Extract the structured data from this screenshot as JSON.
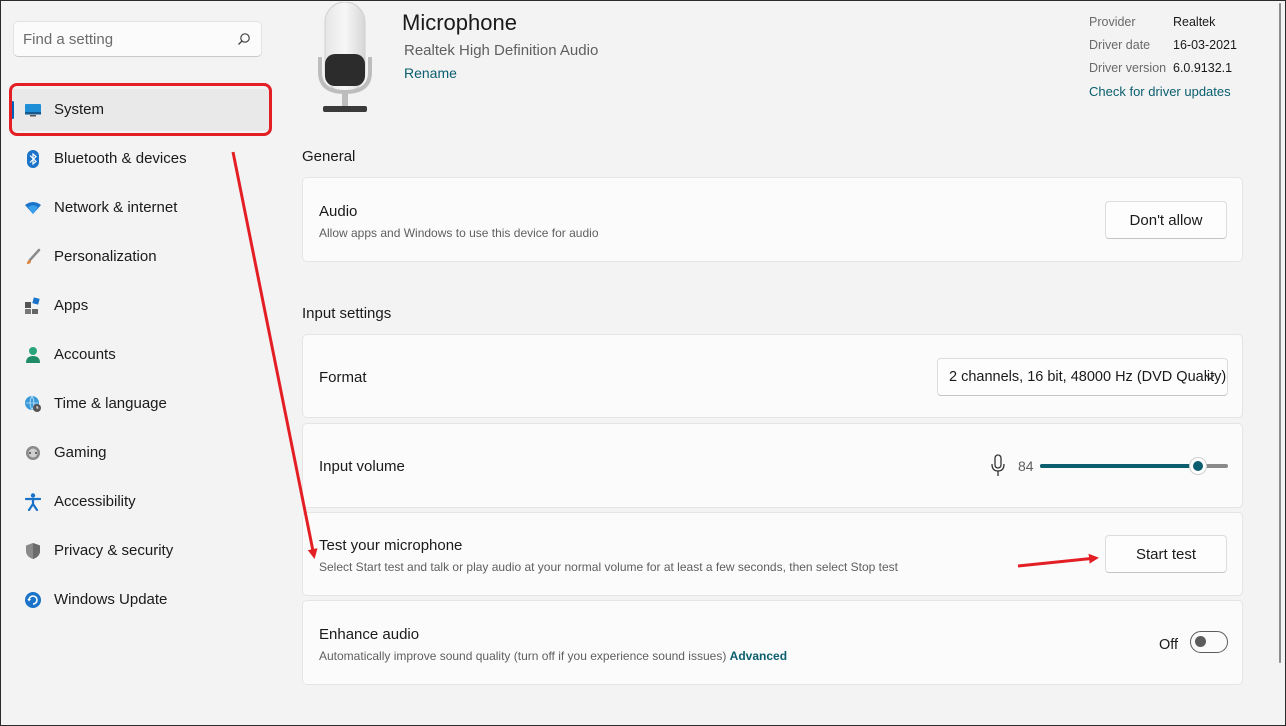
{
  "search": {
    "placeholder": "Find a setting"
  },
  "sidebar": {
    "items": [
      {
        "label": "System",
        "icon": "system-icon",
        "selected": true
      },
      {
        "label": "Bluetooth & devices",
        "icon": "bluetooth-icon"
      },
      {
        "label": "Network & internet",
        "icon": "wifi-icon"
      },
      {
        "label": "Personalization",
        "icon": "brush-icon"
      },
      {
        "label": "Apps",
        "icon": "apps-icon"
      },
      {
        "label": "Accounts",
        "icon": "accounts-icon"
      },
      {
        "label": "Time & language",
        "icon": "globe-clock-icon"
      },
      {
        "label": "Gaming",
        "icon": "gamepad-icon"
      },
      {
        "label": "Accessibility",
        "icon": "accessibility-icon"
      },
      {
        "label": "Privacy & security",
        "icon": "shield-icon"
      },
      {
        "label": "Windows Update",
        "icon": "update-icon"
      }
    ]
  },
  "device": {
    "title": "Microphone",
    "subtitle": "Realtek High Definition Audio",
    "rename_label": "Rename",
    "properties": [
      {
        "label": "Provider",
        "value": "Realtek"
      },
      {
        "label": "Driver date",
        "value": "16-03-2021"
      },
      {
        "label": "Driver version",
        "value": "6.0.9132.1"
      }
    ],
    "driver_link": "Check for driver updates"
  },
  "general": {
    "title": "General",
    "audio": {
      "title": "Audio",
      "description": "Allow apps and Windows to use this device for audio",
      "button": "Don't allow"
    }
  },
  "input": {
    "title": "Input settings",
    "format": {
      "title": "Format",
      "value": "2 channels, 16 bit, 48000 Hz (DVD Quality)"
    },
    "volume": {
      "title": "Input volume",
      "value": "84",
      "level_percent": 84
    },
    "test": {
      "title": "Test your microphone",
      "description": "Select Start test and talk or play audio at your normal volume for at least a few seconds, then select Stop test",
      "button": "Start test"
    },
    "enhance": {
      "title": "Enhance audio",
      "description": "Automatically improve sound quality (turn off if you experience sound issues)",
      "link": "Advanced",
      "state": "Off"
    }
  },
  "colors": {
    "accent": "#0a5e6e",
    "annotation": "#e31e24",
    "selection_bar": "#005fb8"
  }
}
